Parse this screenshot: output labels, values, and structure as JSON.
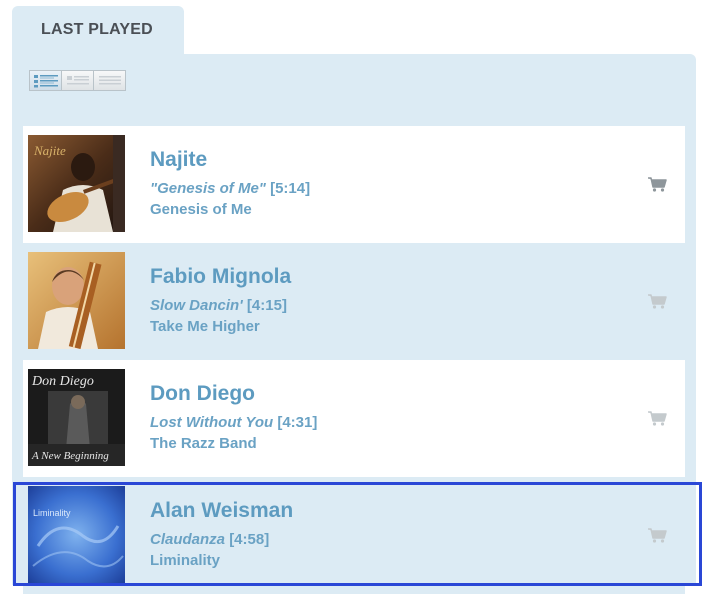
{
  "tab": {
    "label": "LAST PLAYED"
  },
  "view_toggle": {
    "icons": [
      "list-view-icon",
      "compact-view-icon",
      "grid-view-icon"
    ]
  },
  "items": [
    {
      "artist": "Najite",
      "title": "\"Genesis of Me\"",
      "duration": "[5:14]",
      "album": "Genesis of Me"
    },
    {
      "artist": "Fabio Mignola",
      "title": "Slow Dancin'",
      "duration": "[4:15]",
      "album": "Take Me Higher"
    },
    {
      "artist": "Don Diego",
      "title": "Lost Without You",
      "duration": "[4:31]",
      "album": "The Razz Band"
    },
    {
      "artist": "Alan Weisman",
      "title": "Claudanza",
      "duration": "[4:58]",
      "album": "Liminality"
    }
  ],
  "covers": [
    {
      "text": "Najite"
    },
    {
      "text": ""
    },
    {
      "text_top": "Don Diego",
      "text_bottom": "A New Beginning"
    },
    {
      "text": "Liminality"
    }
  ],
  "colors": {
    "panel_bg": "#dcebf4",
    "accent_text": "#5d9bc0",
    "selection": "#2a47d6"
  }
}
